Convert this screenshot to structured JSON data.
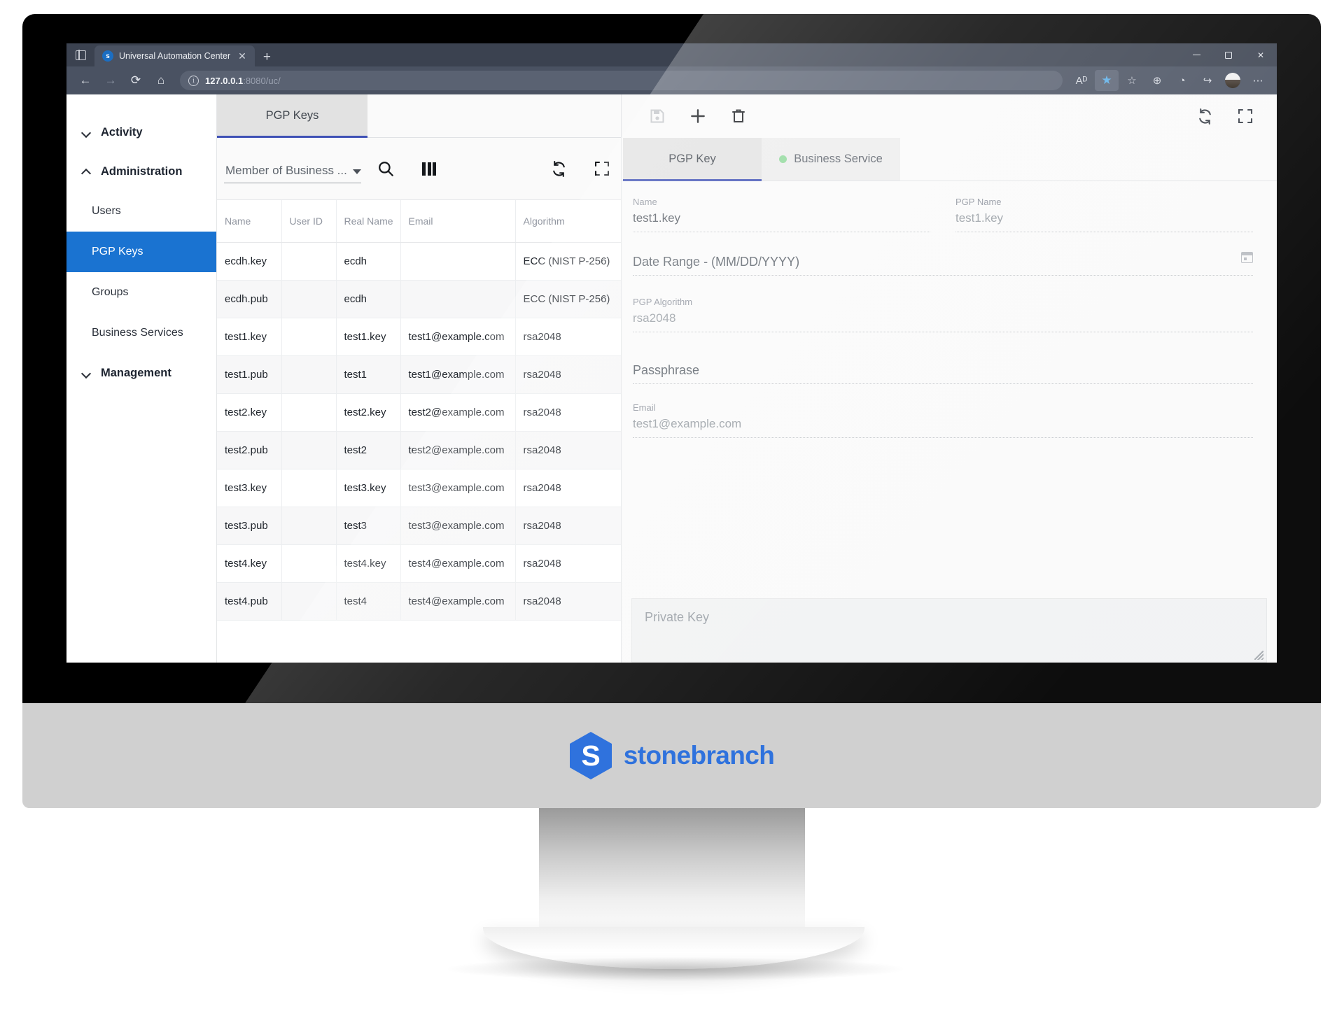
{
  "browser": {
    "tab_strip_icon": "tab-strip-icon",
    "tab": {
      "title": "Universal Automation Center",
      "favicon_letter": "s",
      "close_label": "✕"
    },
    "new_tab_label": "+",
    "url": {
      "host": "127.0.0.1",
      "rest": ":8080/uc/",
      "info_icon": "ⓘ"
    },
    "window_controls": {
      "close": "✕"
    },
    "nav": {
      "back": "←",
      "forward": "→",
      "reload": "⟳",
      "home": "⌂"
    },
    "actions": {
      "read_aloud": "Aᴰ",
      "favorite": "★",
      "collections": "☆",
      "split_screen": "⊕",
      "browser_essentials": "◔",
      "share": "↪",
      "more": "⋯"
    }
  },
  "sidebar": {
    "groups": [
      {
        "label": "Activity",
        "expanded": false,
        "items": []
      },
      {
        "label": "Administration",
        "expanded": true,
        "items": [
          {
            "label": "Users",
            "selected": false
          },
          {
            "label": "PGP Keys",
            "selected": true
          },
          {
            "label": "Groups",
            "selected": false
          },
          {
            "label": "Business Services",
            "selected": false
          }
        ]
      },
      {
        "label": "Management",
        "expanded": false,
        "items": []
      }
    ]
  },
  "list_panel": {
    "tabs": [
      {
        "label": "PGP Keys",
        "active": true
      }
    ],
    "filter_select": {
      "value": "Member of Business ...",
      "caret": "▾"
    },
    "toolbar_icons": [
      {
        "name": "search-icon",
        "label": "Search"
      },
      {
        "name": "columns-icon",
        "label": "Columns"
      },
      {
        "name": "refresh-icon",
        "label": "Refresh"
      },
      {
        "name": "fullscreen-icon",
        "label": "Fullscreen"
      }
    ],
    "table": {
      "columns": [
        "Name",
        "User ID",
        "Real Name",
        "Email",
        "Algorithm"
      ],
      "rows": [
        {
          "name": "ecdh.key",
          "user_id": "",
          "real_name": "ecdh",
          "email": "",
          "algorithm": "ECC (NIST P-256)"
        },
        {
          "name": "ecdh.pub",
          "user_id": "",
          "real_name": "ecdh",
          "email": "",
          "algorithm": "ECC (NIST P-256)"
        },
        {
          "name": "test1.key",
          "user_id": "",
          "real_name": "test1.key",
          "email": "test1@example.com",
          "algorithm": "rsa2048"
        },
        {
          "name": "test1.pub",
          "user_id": "",
          "real_name": "test1",
          "email": "test1@example.com",
          "algorithm": "rsa2048"
        },
        {
          "name": "test2.key",
          "user_id": "",
          "real_name": "test2.key",
          "email": "test2@example.com",
          "algorithm": "rsa2048"
        },
        {
          "name": "test2.pub",
          "user_id": "",
          "real_name": "test2",
          "email": "test2@example.com",
          "algorithm": "rsa2048"
        },
        {
          "name": "test3.key",
          "user_id": "",
          "real_name": "test3.key",
          "email": "test3@example.com",
          "algorithm": "rsa2048"
        },
        {
          "name": "test3.pub",
          "user_id": "",
          "real_name": "test3",
          "email": "test3@example.com",
          "algorithm": "rsa2048"
        },
        {
          "name": "test4.key",
          "user_id": "",
          "real_name": "test4.key",
          "email": "test4@example.com",
          "algorithm": "rsa2048"
        },
        {
          "name": "test4.pub",
          "user_id": "",
          "real_name": "test4",
          "email": "test4@example.com",
          "algorithm": "rsa2048"
        }
      ]
    }
  },
  "detail_panel": {
    "toolbar_icons": [
      {
        "name": "save-icon",
        "label": "Save",
        "disabled": true
      },
      {
        "name": "add-icon",
        "label": "New",
        "disabled": false
      },
      {
        "name": "delete-icon",
        "label": "Delete",
        "disabled": false
      },
      {
        "name": "refresh-icon",
        "label": "Refresh",
        "disabled": false
      },
      {
        "name": "fullscreen-icon",
        "label": "Fullscreen",
        "disabled": false
      }
    ],
    "tabs": [
      {
        "label": "PGP Key",
        "active": true,
        "dot": false
      },
      {
        "label": "Business Service",
        "active": false,
        "dot": true,
        "dot_color": "#8fd99a"
      }
    ],
    "fields": {
      "name": {
        "label": "Name",
        "value": "test1.key"
      },
      "pgp_name": {
        "label": "PGP Name",
        "value": "test1.key"
      },
      "date_range": {
        "label": "Date Range - (MM/DD/YYYY)",
        "value": ""
      },
      "pgp_algorithm": {
        "label": "PGP Algorithm",
        "value": "rsa2048"
      },
      "passphrase": {
        "label": "Passphrase",
        "value": ""
      },
      "email": {
        "label": "Email",
        "value": "test1@example.com"
      },
      "private_key": {
        "label": "Private Key",
        "value": ""
      }
    }
  },
  "branding": {
    "wordmark": "stonebranch",
    "mark_letter": "S",
    "brand_color": "#2f72dd"
  }
}
